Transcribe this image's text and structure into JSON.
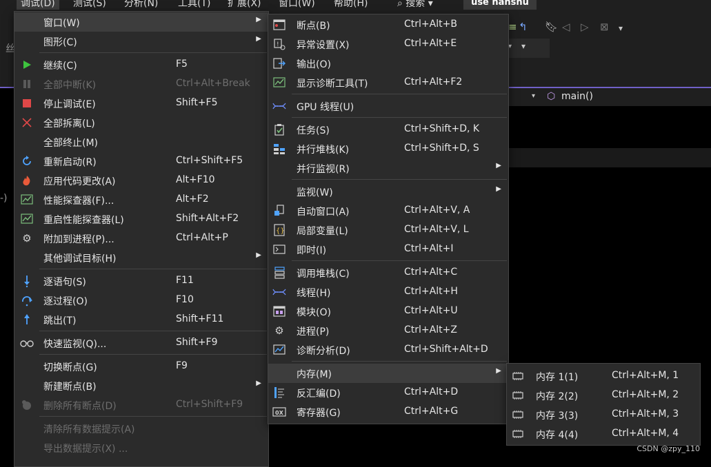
{
  "menubar": {
    "items": [
      "调试(D)",
      "测试(S)",
      "分析(N)",
      "工具(T)",
      "扩展(X)",
      "窗口(W)",
      "帮助(H)"
    ],
    "search": "搜索",
    "solution": "use hanshu"
  },
  "editor": {
    "function_combo": "main()",
    "left_chars": [
      "丝",
      "-)"
    ]
  },
  "debug_menu": {
    "items": [
      {
        "label": "窗口(W)",
        "shortcut": "",
        "icon": "",
        "submenu": true,
        "highlight": true
      },
      {
        "label": "图形(C)",
        "shortcut": "",
        "icon": "",
        "submenu": true
      },
      {
        "sep": true
      },
      {
        "label": "继续(C)",
        "shortcut": "F5",
        "icon": "play-icon"
      },
      {
        "label": "全部中断(K)",
        "shortcut": "Ctrl+Alt+Break",
        "icon": "pause-icon",
        "disabled": true
      },
      {
        "label": "停止调试(E)",
        "shortcut": "Shift+F5",
        "icon": "stop-icon"
      },
      {
        "label": "全部拆离(L)",
        "shortcut": "",
        "icon": "close-icon"
      },
      {
        "label": "全部终止(M)",
        "shortcut": "",
        "icon": ""
      },
      {
        "label": "重新启动(R)",
        "shortcut": "Ctrl+Shift+F5",
        "icon": "restart-icon"
      },
      {
        "label": "应用代码更改(A)",
        "shortcut": "Alt+F10",
        "icon": "hot-reload-icon"
      },
      {
        "label": "性能探查器(F)...",
        "shortcut": "Alt+F2",
        "icon": "profiler-icon"
      },
      {
        "label": "重启性能探查器(L)",
        "shortcut": "Shift+Alt+F2",
        "icon": "profiler-icon"
      },
      {
        "label": "附加到进程(P)...",
        "shortcut": "Ctrl+Alt+P",
        "icon": "gears-icon"
      },
      {
        "label": "其他调试目标(H)",
        "shortcut": "",
        "icon": "",
        "submenu": true
      },
      {
        "sep": true
      },
      {
        "label": "逐语句(S)",
        "shortcut": "F11",
        "icon": "step-into-icon"
      },
      {
        "label": "逐过程(O)",
        "shortcut": "F10",
        "icon": "step-over-icon"
      },
      {
        "label": "跳出(T)",
        "shortcut": "Shift+F11",
        "icon": "step-out-icon"
      },
      {
        "sep": true
      },
      {
        "label": "快速监视(Q)...",
        "shortcut": "Shift+F9",
        "icon": "glasses-icon"
      },
      {
        "sep": true
      },
      {
        "label": "切换断点(G)",
        "shortcut": "F9",
        "icon": ""
      },
      {
        "label": "新建断点(B)",
        "shortcut": "",
        "icon": "",
        "submenu": true
      },
      {
        "label": "删除所有断点(D)",
        "shortcut": "Ctrl+Shift+F9",
        "icon": "delete-breakpoints-icon",
        "disabled": true
      },
      {
        "sep": true
      },
      {
        "label": "清除所有数据提示(A)",
        "shortcut": "",
        "icon": "",
        "disabled": true
      },
      {
        "label": "导出数据提示(X) ...",
        "shortcut": "",
        "icon": "",
        "disabled": true
      }
    ]
  },
  "window_menu": {
    "items": [
      {
        "label": "断点(B)",
        "shortcut": "Ctrl+Alt+B",
        "icon": "breakpoints-window-icon"
      },
      {
        "label": "异常设置(X)",
        "shortcut": "Ctrl+Alt+E",
        "icon": "exception-settings-icon"
      },
      {
        "label": "输出(O)",
        "shortcut": "",
        "icon": "output-icon"
      },
      {
        "label": "显示诊断工具(T)",
        "shortcut": "Ctrl+Alt+F2",
        "icon": "diagnostic-tools-icon"
      },
      {
        "sep": true
      },
      {
        "label": "GPU 线程(U)",
        "shortcut": "",
        "icon": "gpu-threads-icon"
      },
      {
        "sep": true
      },
      {
        "label": "任务(S)",
        "shortcut": "Ctrl+Shift+D, K",
        "icon": "tasks-icon"
      },
      {
        "label": "并行堆栈(K)",
        "shortcut": "Ctrl+Shift+D, S",
        "icon": "parallel-stacks-icon"
      },
      {
        "label": "并行监视(R)",
        "shortcut": "",
        "icon": "",
        "submenu": true
      },
      {
        "sep": true
      },
      {
        "label": "监视(W)",
        "shortcut": "",
        "icon": "",
        "submenu": true
      },
      {
        "label": "自动窗口(A)",
        "shortcut": "Ctrl+Alt+V, A",
        "icon": "autos-icon"
      },
      {
        "label": "局部变量(L)",
        "shortcut": "Ctrl+Alt+V, L",
        "icon": "locals-icon"
      },
      {
        "label": "即时(I)",
        "shortcut": "Ctrl+Alt+I",
        "icon": "immediate-icon"
      },
      {
        "sep": true
      },
      {
        "label": "调用堆栈(C)",
        "shortcut": "Ctrl+Alt+C",
        "icon": "call-stack-icon"
      },
      {
        "label": "线程(H)",
        "shortcut": "Ctrl+Alt+H",
        "icon": "threads-icon"
      },
      {
        "label": "模块(O)",
        "shortcut": "Ctrl+Alt+U",
        "icon": "modules-icon"
      },
      {
        "label": "进程(P)",
        "shortcut": "Ctrl+Alt+Z",
        "icon": "processes-icon"
      },
      {
        "label": "诊断分析(D)",
        "shortcut": "Ctrl+Shift+Alt+D",
        "icon": "diagnostic-analysis-icon"
      },
      {
        "sep": true
      },
      {
        "label": "内存(M)",
        "shortcut": "",
        "icon": "",
        "submenu": true,
        "highlight": true
      },
      {
        "label": "反汇编(D)",
        "shortcut": "Ctrl+Alt+D",
        "icon": "disassembly-icon"
      },
      {
        "label": "寄存器(G)",
        "shortcut": "Ctrl+Alt+G",
        "icon": "registers-icon"
      }
    ]
  },
  "memory_menu": {
    "items": [
      {
        "label": "内存 1(1)",
        "shortcut": "Ctrl+Alt+M, 1",
        "icon": "memory-chip-icon"
      },
      {
        "label": "内存 2(2)",
        "shortcut": "Ctrl+Alt+M, 2",
        "icon": "memory-chip-icon"
      },
      {
        "label": "内存 3(3)",
        "shortcut": "Ctrl+Alt+M, 3",
        "icon": "memory-chip-icon"
      },
      {
        "label": "内存 4(4)",
        "shortcut": "Ctrl+Alt+M, 4",
        "icon": "memory-chip-icon"
      }
    ]
  },
  "watermark": "CSDN @zpy_110",
  "colors": {
    "menu_bg": "#2b2b2b",
    "highlight": "#3d3d3d",
    "accent_purple": "#7060c8",
    "play_green": "#3ec43e",
    "stop_red": "#e04848"
  }
}
